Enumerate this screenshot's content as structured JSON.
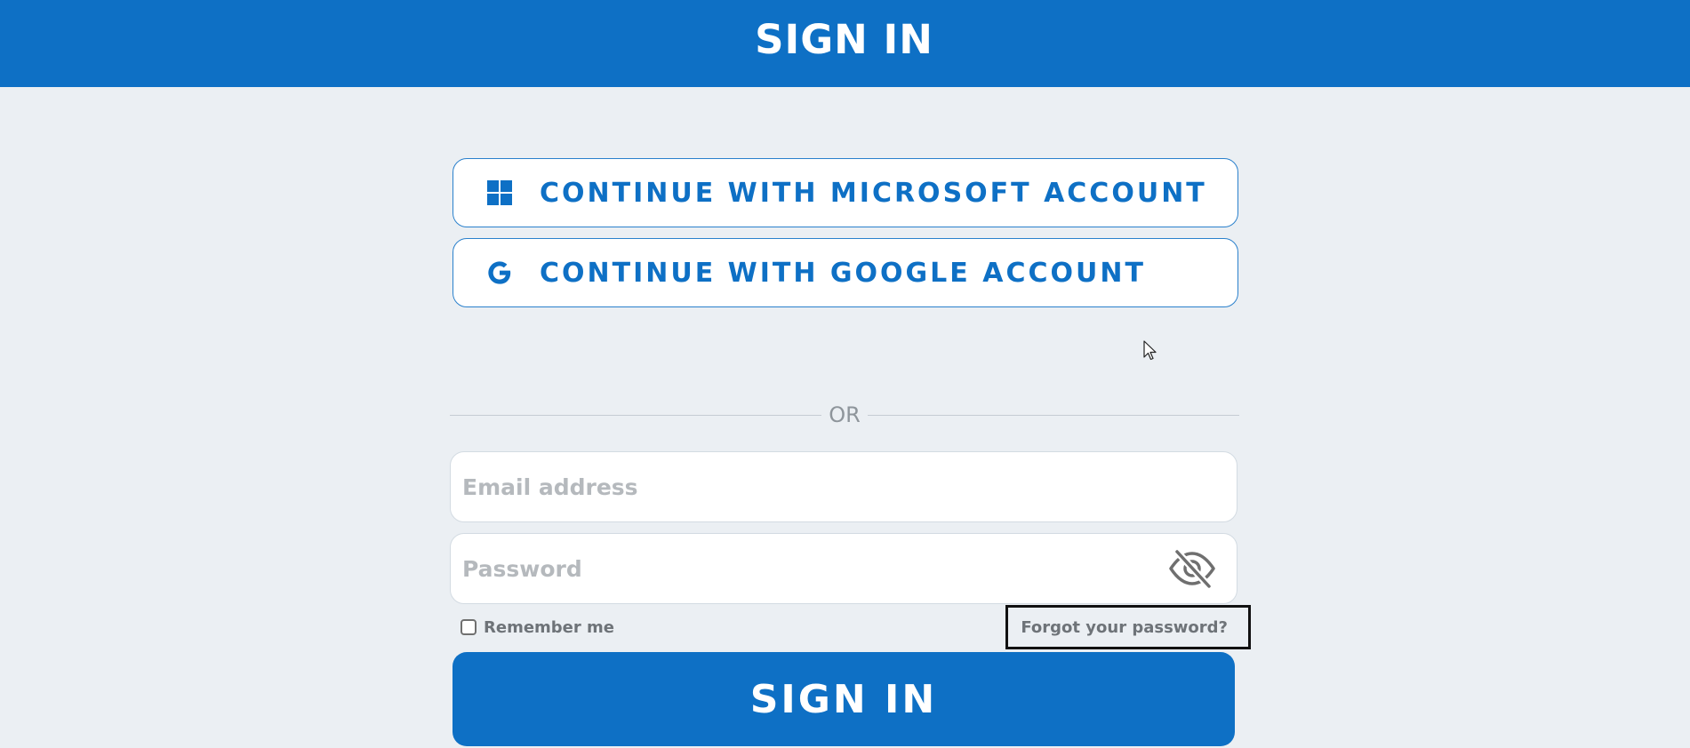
{
  "header": {
    "title": "SIGN IN"
  },
  "oauth": {
    "microsoft": {
      "label": "CONTINUE WITH MICROSOFT ACCOUNT",
      "icon": "windows-icon"
    },
    "google": {
      "label": "CONTINUE WITH GOOGLE ACCOUNT",
      "icon": "google-icon"
    }
  },
  "divider": {
    "text": "OR"
  },
  "form": {
    "email": {
      "value": "",
      "placeholder": "Email address"
    },
    "password": {
      "value": "",
      "placeholder": "Password",
      "toggle_icon": "eye-slash-icon"
    },
    "remember_me": {
      "label": "Remember me",
      "checked": false
    },
    "forgot_password": {
      "label": "Forgot your password?"
    },
    "submit": {
      "label": "SIGN IN"
    }
  },
  "colors": {
    "primary": "#0e70c5",
    "background": "#ebeff3",
    "muted_text": "#6e7378",
    "placeholder": "#b5b9bd"
  }
}
